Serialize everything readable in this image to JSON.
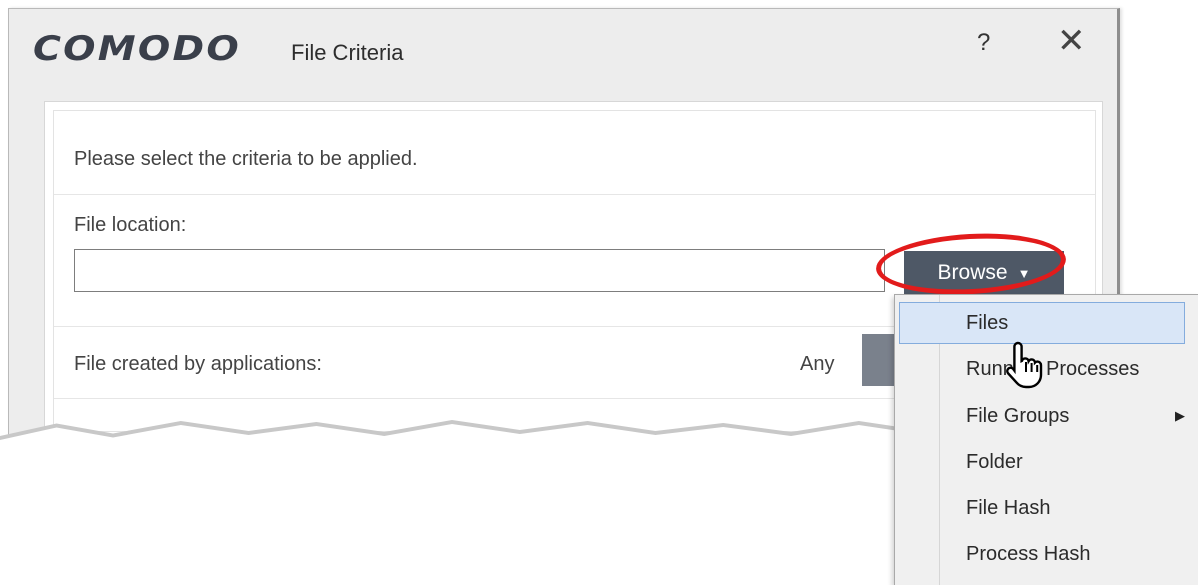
{
  "dialog": {
    "brand": "COMODO",
    "title": "File Criteria",
    "help_label": "?",
    "close_label": "✕"
  },
  "criteria": {
    "instruction": "Please select the criteria to be applied.",
    "file_location_label": "File location:",
    "file_location_value": "",
    "browse_label": "Browse",
    "created_by_label": "File created by applications:",
    "created_by_value": "Any"
  },
  "browse_menu": {
    "items": [
      {
        "label": "Files",
        "highlighted": true
      },
      {
        "label": "Running Processes"
      },
      {
        "label": "File Groups",
        "submenu": true
      },
      {
        "label": "Folder"
      },
      {
        "label": "File Hash"
      },
      {
        "label": "Process Hash"
      }
    ]
  },
  "colors": {
    "button_dark": "#4e5866",
    "highlight_ring": "#e21b1b",
    "menu_highlight": "#d9e6f7"
  }
}
